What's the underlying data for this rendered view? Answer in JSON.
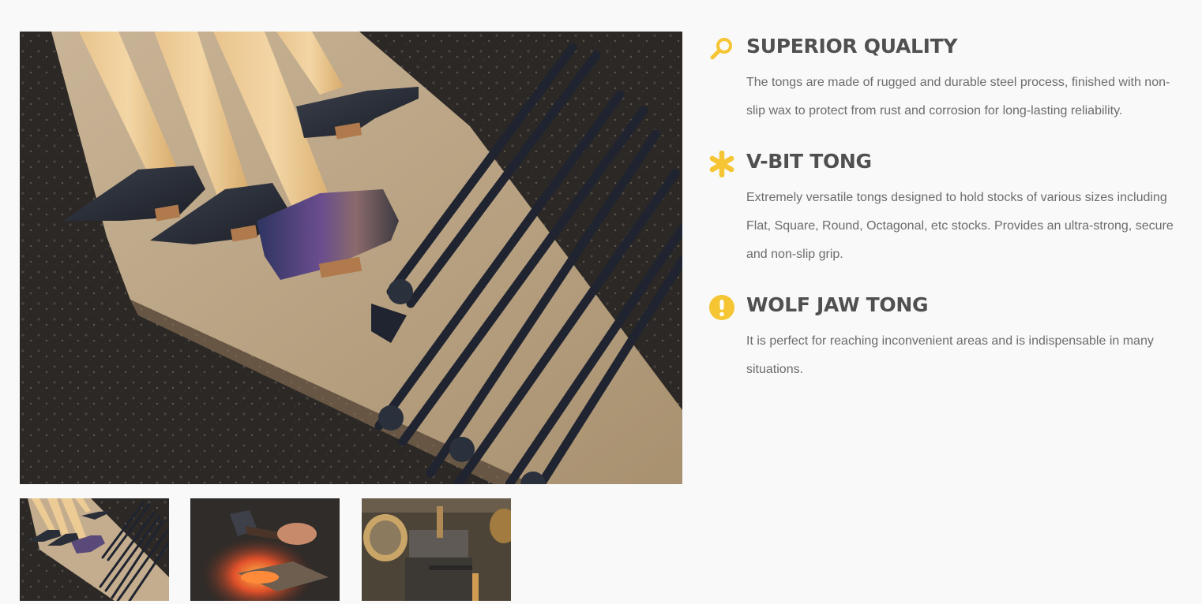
{
  "gallery": {
    "main_image_subject": "blacksmith hammers and tongs on wooden board",
    "thumbnails": [
      {
        "subject": "hammers and tongs on wooden board"
      },
      {
        "subject": "hammer striking glowing hot metal"
      },
      {
        "subject": "blacksmith workshop with anvil and tools"
      }
    ]
  },
  "features": [
    {
      "icon": "magnifier-icon",
      "title": "SUPERIOR QUALITY",
      "text": "The tongs are made of rugged and durable steel process, finished with non-slip wax to protect from rust and corrosion for long-lasting reliability."
    },
    {
      "icon": "asterisk-icon",
      "title": "V-BIT TONG",
      "text": "Extremely versatile tongs designed to hold stocks of various sizes including Flat, Square, Round, Octagonal, etc stocks. Provides an ultra-strong, secure and non-slip grip."
    },
    {
      "icon": "exclamation-icon",
      "title": "WOLF JAW TONG",
      "text": "It is perfect for reaching inconvenient areas and is indispensable in many situations."
    }
  ],
  "colors": {
    "accent": "#f5c533",
    "heading": "#505050",
    "body_text": "#6c6c6c",
    "background": "#f9f9f9"
  }
}
